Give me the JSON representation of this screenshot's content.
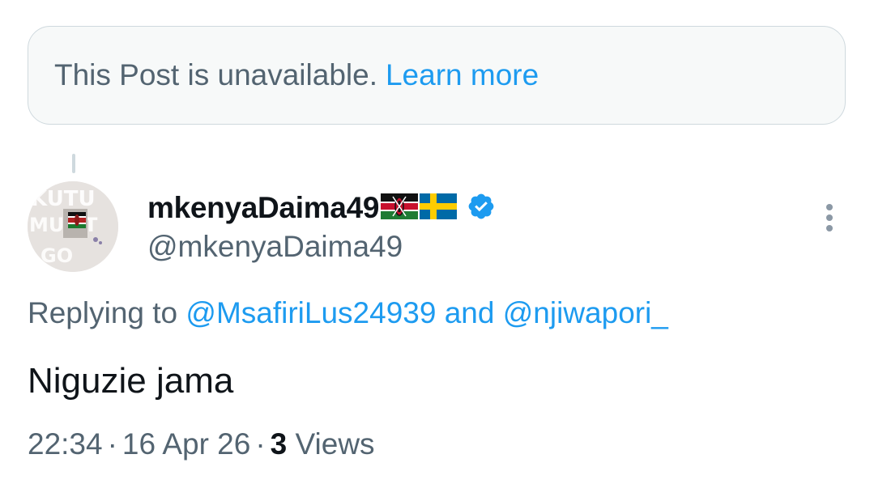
{
  "unavailable_notice": {
    "text": "This Post is unavailable.",
    "link_label": "Learn more"
  },
  "post": {
    "author": {
      "display_name": "mkenyaDaima49",
      "flags": [
        "kenya-flag",
        "sweden-flag"
      ],
      "verified": true,
      "handle": "@mkenyaDaima49"
    },
    "replying_to": {
      "prefix": "Replying to",
      "mentions": [
        "@MsafiriLus24939",
        "@njiwapori_"
      ],
      "joiner": "and"
    },
    "text": "Niguzie jama",
    "time": "22:34",
    "date": "16 Apr 26",
    "views_count": "3",
    "views_label": "Views",
    "separator": "·"
  },
  "colors": {
    "accent": "#1d9bf0",
    "secondary_text": "#536471",
    "primary_text": "#0f1419",
    "border": "#cfd9de",
    "notice_bg": "#f7f9f9"
  },
  "icons": {
    "verified": "verified-badge-icon",
    "more": "more-vertical-icon",
    "avatar": "avatar-image"
  }
}
